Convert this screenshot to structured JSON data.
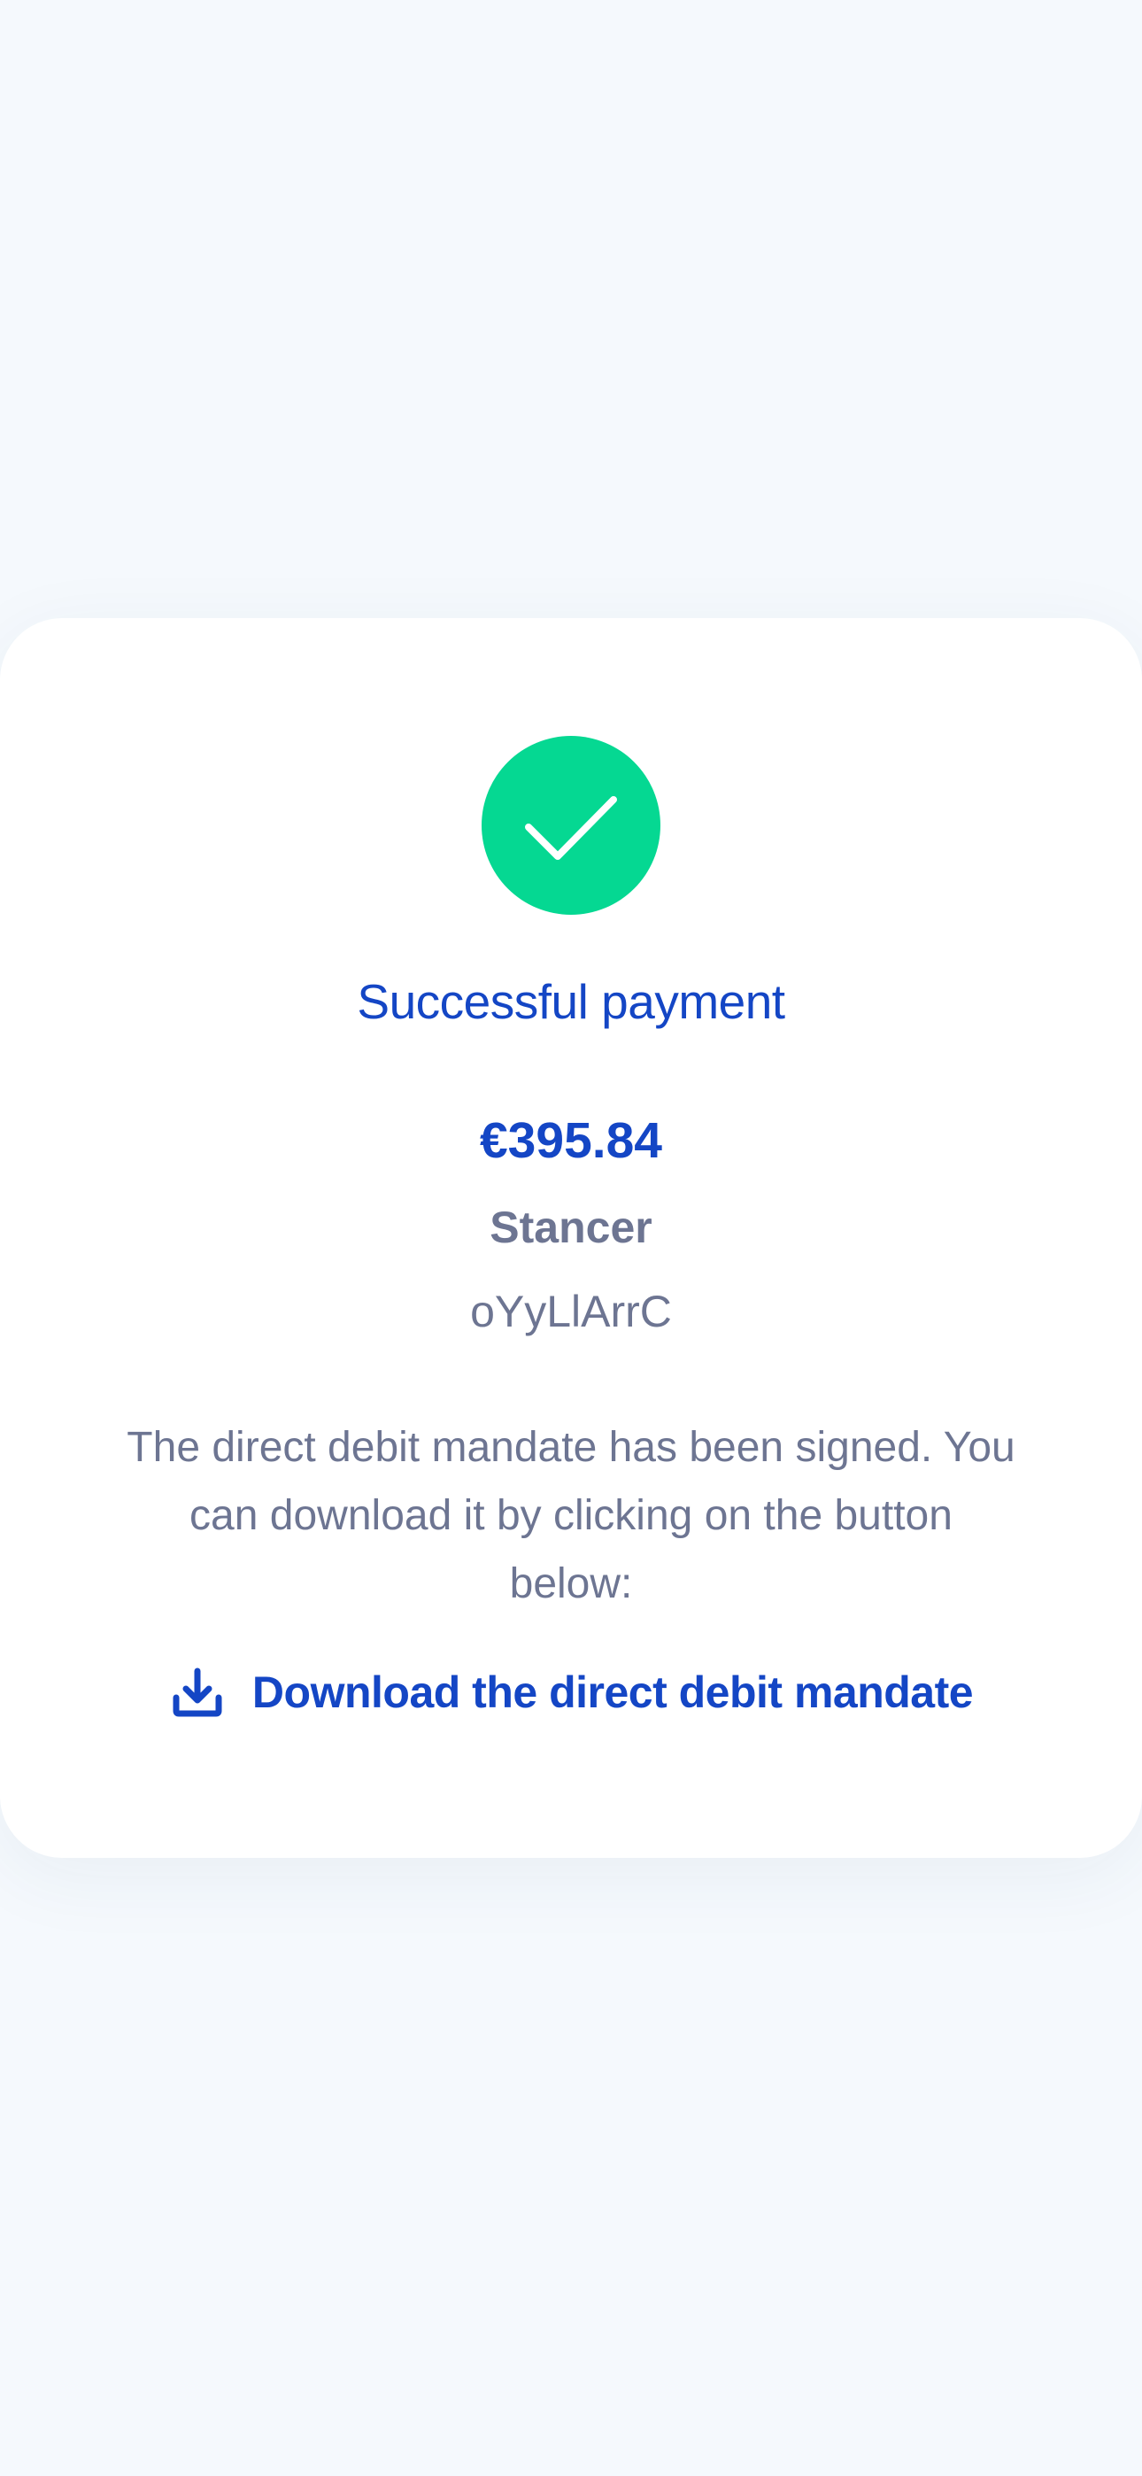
{
  "colors": {
    "page_background": "#f5f9fd",
    "card_background": "#ffffff",
    "success": "#05d892",
    "primary": "#1446c5",
    "muted": "#6d7592"
  },
  "status": {
    "icon": "checkmark-icon",
    "title": "Successful payment"
  },
  "payment": {
    "amount": "€395.84",
    "merchant": "Stancer",
    "reference": "oYyLlArrC"
  },
  "mandate": {
    "message": "The direct debit mandate has been signed. You can download it by clicking on the button below:",
    "download_icon": "download-icon",
    "download_label": "Download the direct debit mandate"
  }
}
